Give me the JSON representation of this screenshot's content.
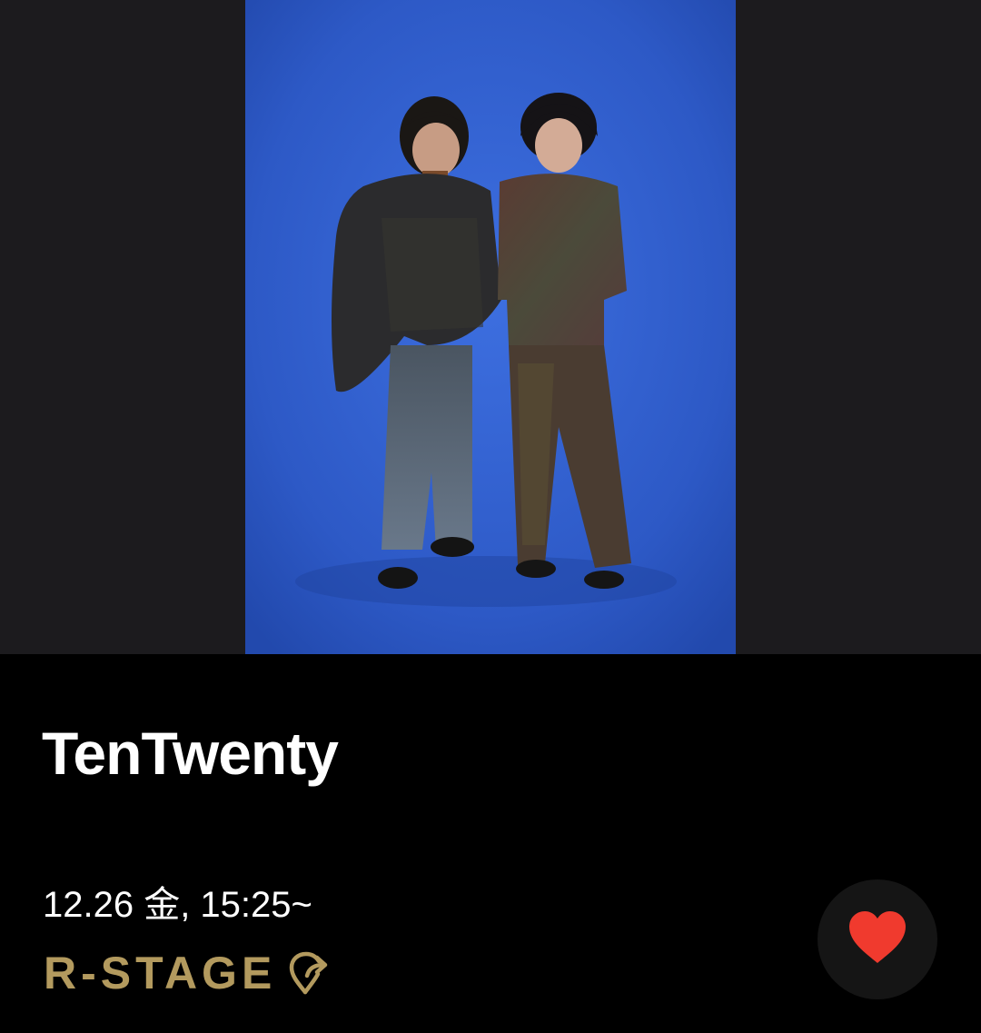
{
  "artist": {
    "name": "TenTwenty",
    "photo_alt": "TenTwenty"
  },
  "schedule": {
    "datetime": "12.26 金, 15:25~"
  },
  "stage": {
    "label": "R-STAGE",
    "icon": "map-pin-share-icon"
  },
  "favorite": {
    "icon": "heart-icon",
    "active": true
  },
  "colors": {
    "photo_bg": "#2f5fd0",
    "stage_accent": "#b39a5e",
    "heart": "#f03a2e",
    "side_bg": "#1c1b1e"
  }
}
